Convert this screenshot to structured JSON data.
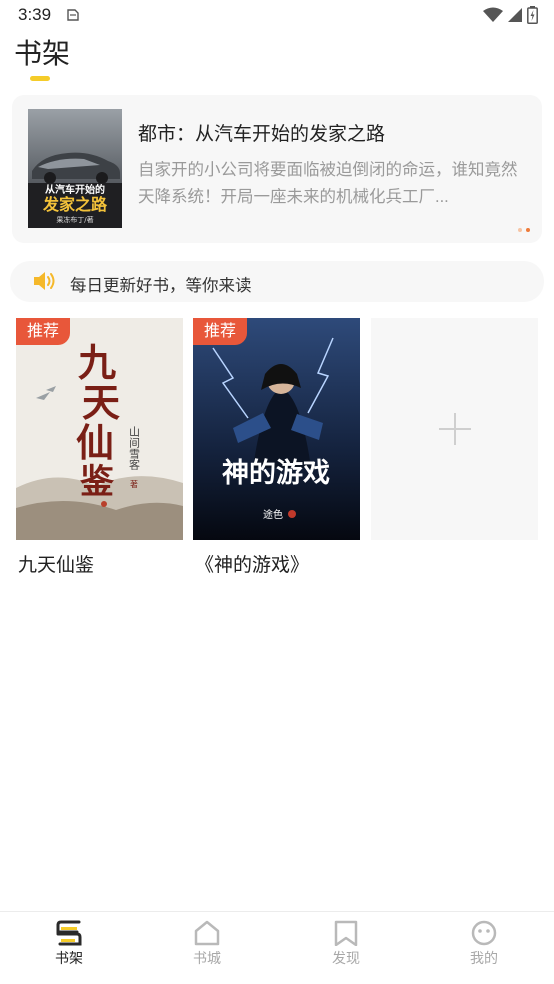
{
  "status_bar": {
    "time": "3:39"
  },
  "header": {
    "title": "书架"
  },
  "banner": {
    "title": "都市：从汽车开始的发家之路",
    "description": "自家开的小公司将要面临被迫倒闭的命运，谁知竟然天降系统！开局一座未来的机械化兵工厂...",
    "cover": {
      "line1": "从汽车开始的",
      "line2": "发家之路",
      "author": "果冻布丁/著"
    },
    "dot_colors": [
      "#f6c4a4",
      "#ee7b3a"
    ]
  },
  "notice": {
    "text": "每日更新好书，等你来读"
  },
  "books": [
    {
      "name": "九天仙鉴",
      "badge": "推荐",
      "cover": {
        "title_chars": [
          "九",
          "天",
          "仙",
          "鉴"
        ],
        "author": "山间雪客",
        "author_mark": "著"
      }
    },
    {
      "name": "《神的游戏》",
      "badge": "推荐",
      "cover": {
        "title": "神的游戏",
        "author": "途色"
      }
    }
  ],
  "bottom_nav": {
    "items": [
      {
        "label": "书架",
        "icon": "bookshelf-icon",
        "active": true
      },
      {
        "label": "书城",
        "icon": "bookstore-icon",
        "active": false
      },
      {
        "label": "发现",
        "icon": "bookmark-icon",
        "active": false
      },
      {
        "label": "我的",
        "icon": "profile-face-icon",
        "active": false
      }
    ]
  },
  "colors": {
    "accent_yellow": "#f5cc2a",
    "badge_red": "#e8573a",
    "inactive_gray": "#a8a8a8"
  }
}
